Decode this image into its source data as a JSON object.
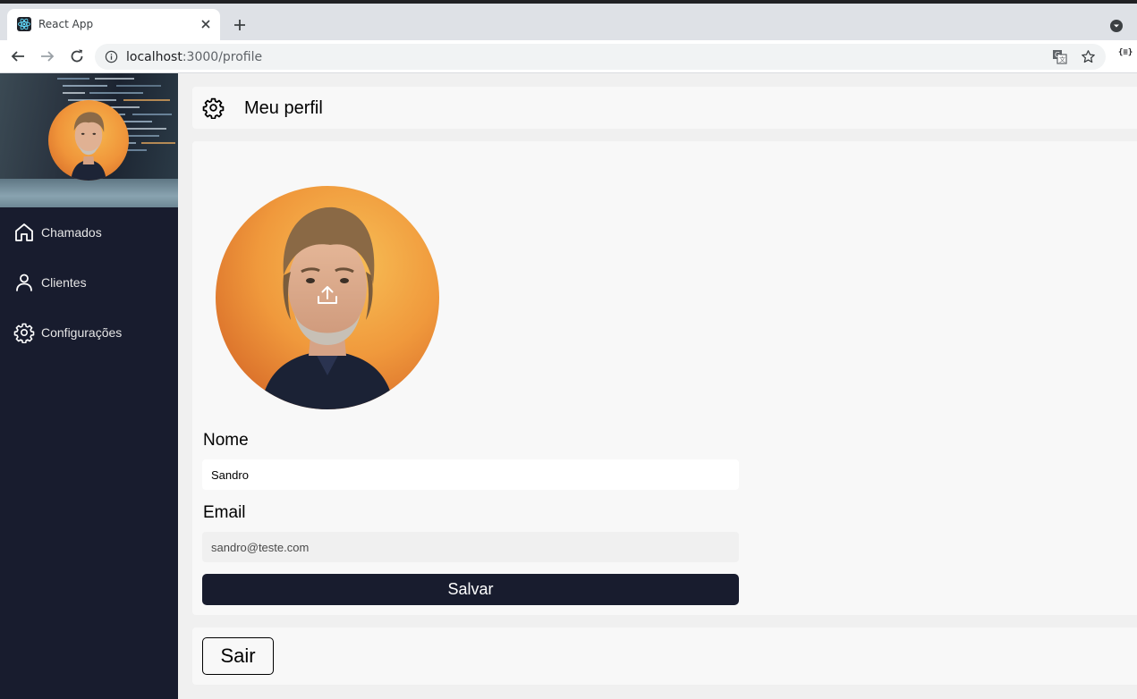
{
  "browser": {
    "tab_title": "React App",
    "url_host": "localhost",
    "url_path": ":3000/profile",
    "extension_label": "{≡}"
  },
  "sidebar": {
    "items": [
      {
        "label": "Chamados",
        "icon": "home-icon"
      },
      {
        "label": "Clientes",
        "icon": "user-icon"
      },
      {
        "label": "Configurações",
        "icon": "gear-icon"
      }
    ]
  },
  "header": {
    "title": "Meu perfil",
    "icon": "gear-icon"
  },
  "profile": {
    "name_label": "Nome",
    "name_value": "Sandro",
    "email_label": "Email",
    "email_value": "sandro@teste.com",
    "save_label": "Salvar",
    "upload_icon": "upload-icon"
  },
  "logout": {
    "label": "Sair"
  },
  "colors": {
    "sidebar": "#181c2e",
    "button": "#181c2e",
    "card": "#f8f8f8",
    "background": "#f0f0f0"
  }
}
